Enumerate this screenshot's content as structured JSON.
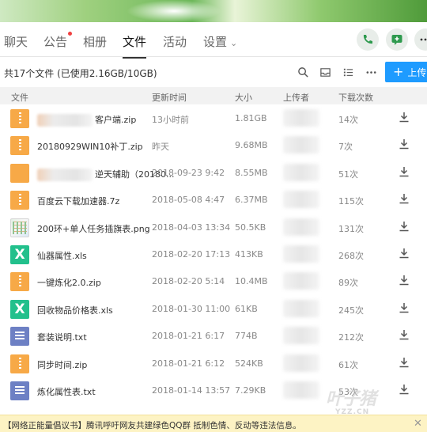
{
  "nav": {
    "tabs": [
      "聊天",
      "公告",
      "相册",
      "文件",
      "活动"
    ],
    "settings_label": "设置"
  },
  "toolbar": {
    "file_count": "共17个文件 (已使用2.16GB/10GB)",
    "upload_label": "上传"
  },
  "table": {
    "headers": {
      "file": "文件",
      "time": "更新时间",
      "size": "大小",
      "uploader": "上传者",
      "downloads": "下载次数"
    },
    "rows": [
      {
        "type": "zip",
        "name": "客户端.zip",
        "redacted": true,
        "time": "13小时前",
        "size": "1.81GB",
        "downloads": "14次"
      },
      {
        "type": "zip",
        "name": "20180929WIN10补丁.zip",
        "time": "昨天",
        "size": "9.68MB",
        "downloads": "7次"
      },
      {
        "type": "exe",
        "name": "逆天辅助（20180...",
        "redacted": true,
        "time": "2018-09-23 9:42",
        "size": "8.55MB",
        "downloads": "51次"
      },
      {
        "type": "zip",
        "name": "百度云下载加速器.7z",
        "time": "2018-05-08 4:47",
        "size": "6.37MB",
        "downloads": "115次"
      },
      {
        "type": "png",
        "name": "200环+单人任务插旗表.png",
        "time": "2018-04-03 13:34",
        "size": "50.5KB",
        "downloads": "131次"
      },
      {
        "type": "xls",
        "name": "仙器属性.xls",
        "time": "2018-02-20 17:13",
        "size": "413KB",
        "downloads": "268次"
      },
      {
        "type": "zip",
        "name": "一键炼化2.0.zip",
        "time": "2018-02-20 5:14",
        "size": "10.4MB",
        "downloads": "89次"
      },
      {
        "type": "xls",
        "name": "回收物品价格表.xls",
        "time": "2018-01-30 11:00",
        "size": "61KB",
        "downloads": "245次"
      },
      {
        "type": "txt",
        "name": "套装说明.txt",
        "time": "2018-01-21 6:17",
        "size": "774B",
        "downloads": "212次"
      },
      {
        "type": "zip",
        "name": "同步时间.zip",
        "time": "2018-01-21 6:12",
        "size": "524KB",
        "downloads": "61次"
      },
      {
        "type": "txt",
        "name": "炼化属性表.txt",
        "time": "2018-01-14 13:57",
        "size": "7.29KB",
        "downloads": "53次"
      }
    ]
  },
  "watermark": {
    "main": "叶子猪",
    "sub": "YZZ.CN"
  },
  "notice": {
    "text": "【网络正能量倡议书】腾讯呼吁网友共建绿色QQ群 抵制色情、反动等违法信息。",
    "close": "✕"
  },
  "colors": {
    "accent": "#1e9bff",
    "zip": "#f7a947",
    "xls": "#22c08c",
    "txt": "#6d80c4",
    "notice_bg": "#fdf3c4"
  }
}
